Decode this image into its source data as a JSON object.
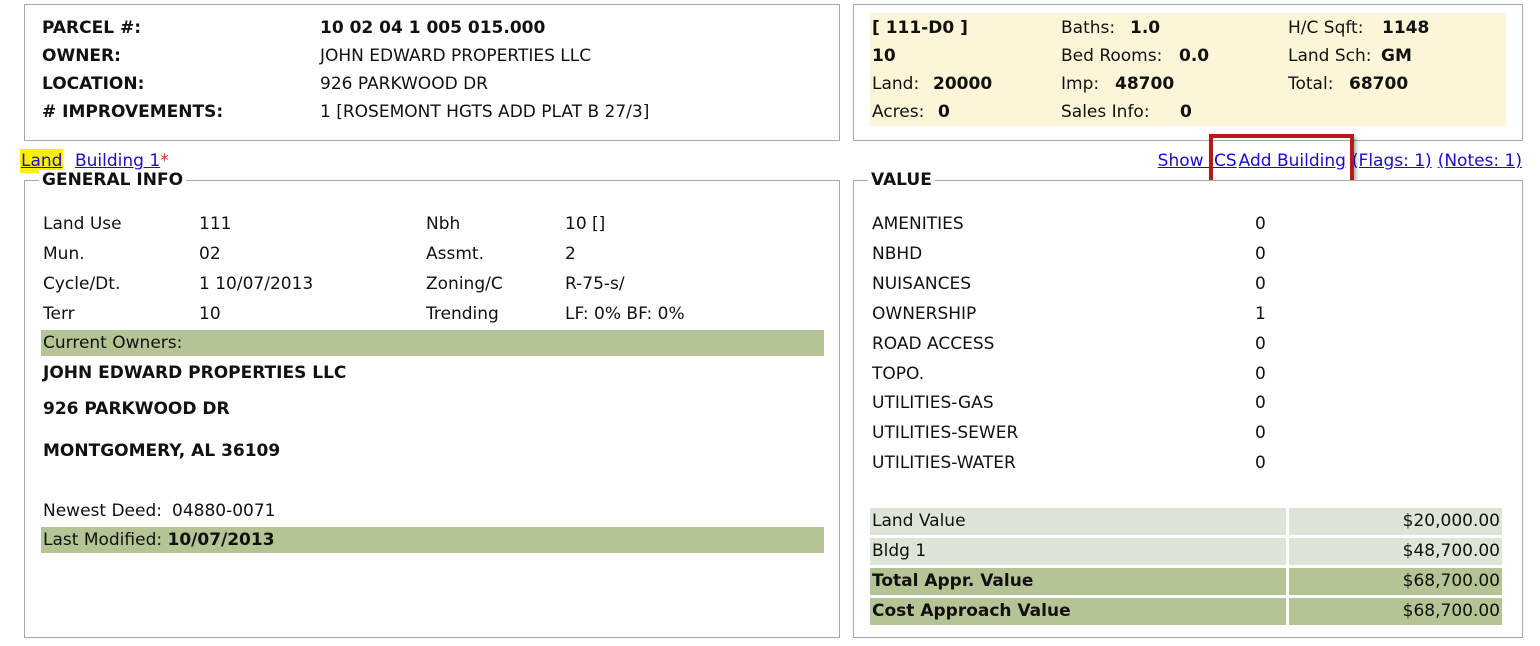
{
  "parcel": {
    "parcel_label": "PARCEL #:",
    "parcel_value": "10 02 04 1 005 015.000",
    "owner_label": "OWNER:",
    "owner_value": "JOHN EDWARD PROPERTIES LLC",
    "location_label": "LOCATION:",
    "location_value": "926 PARKWOOD DR",
    "improvements_label": "# IMPROVEMENTS:",
    "improvements_value": "1 [ROSEMONT HGTS ADD PLAT B 27/3]"
  },
  "summary": {
    "code": "[ 111-D0 ]",
    "code_line2": "10",
    "land_label": "Land:",
    "land_value": "20000",
    "acres_label": "Acres:",
    "acres_value": "0",
    "baths_label": "Baths:",
    "baths_value": "1.0",
    "bedrooms_label": "Bed Rooms:",
    "bedrooms_value": "0.0",
    "imp_label": "Imp:",
    "imp_value": "48700",
    "sales_label": "Sales Info:",
    "sales_value": "0",
    "hc_sqft_label": "H/C Sqft:",
    "hc_sqft_value": "1148",
    "land_sch_label": "Land Sch:",
    "land_sch_value": "GM",
    "total_label": "Total:",
    "total_value": "68700"
  },
  "tabs": {
    "land": "Land",
    "building": "Building 1",
    "building_marker": "*"
  },
  "actions": {
    "show_ics": "Show ICS",
    "add_building": "Add Building",
    "flags": "(Flags: 1)",
    "notes": "(Notes: 1)"
  },
  "general": {
    "legend": "GENERAL INFO",
    "fields": [
      {
        "label": "Land Use",
        "value": "111",
        "label2": "Nbh",
        "value2": "10 []"
      },
      {
        "label": "Mun.",
        "value": "02",
        "label2": "Assmt.",
        "value2": "2"
      },
      {
        "label": "Cycle/Dt.",
        "value": "1 10/07/2013",
        "label2": "Zoning/C",
        "value2": "R-75-s/"
      },
      {
        "label": "Terr",
        "value": "10",
        "label2": "Trending",
        "value2": "LF: 0% BF: 0%"
      }
    ],
    "current_owners_label": "Current Owners:",
    "owner_name": "JOHN EDWARD PROPERTIES LLC",
    "owner_address": "926 PARKWOOD DR",
    "owner_city": "MONTGOMERY, AL 36109",
    "newest_deed_label": "Newest Deed:",
    "newest_deed_value": "04880-0071",
    "last_modified_label": "Last Modified:",
    "last_modified_value": "10/07/2013"
  },
  "value": {
    "legend": "VALUE",
    "items": [
      {
        "label": "AMENITIES",
        "value": "0"
      },
      {
        "label": "NBHD",
        "value": "0"
      },
      {
        "label": "NUISANCES",
        "value": "0"
      },
      {
        "label": "OWNERSHIP",
        "value": "1"
      },
      {
        "label": "ROAD ACCESS",
        "value": "0"
      },
      {
        "label": "TOPO.",
        "value": "0"
      },
      {
        "label": "UTILITIES-GAS",
        "value": "0"
      },
      {
        "label": "UTILITIES-SEWER",
        "value": "0"
      },
      {
        "label": "UTILITIES-WATER",
        "value": "0"
      }
    ],
    "totals": [
      {
        "label": "Land Value",
        "amount": "$20,000.00"
      },
      {
        "label": "Bldg 1",
        "amount": "$48,700.00"
      },
      {
        "label": "Total Appr. Value",
        "amount": "$68,700.00"
      },
      {
        "label": "Cost Approach Value",
        "amount": "$68,700.00"
      }
    ]
  },
  "colors": {
    "summary_bg": "#fdf5d8",
    "green_bar": "#b5c495",
    "light_green": "#dce5d8",
    "link": "#1a0dcc",
    "highlight_border": "#b31a1a",
    "tab_highlight": "#fff000"
  }
}
